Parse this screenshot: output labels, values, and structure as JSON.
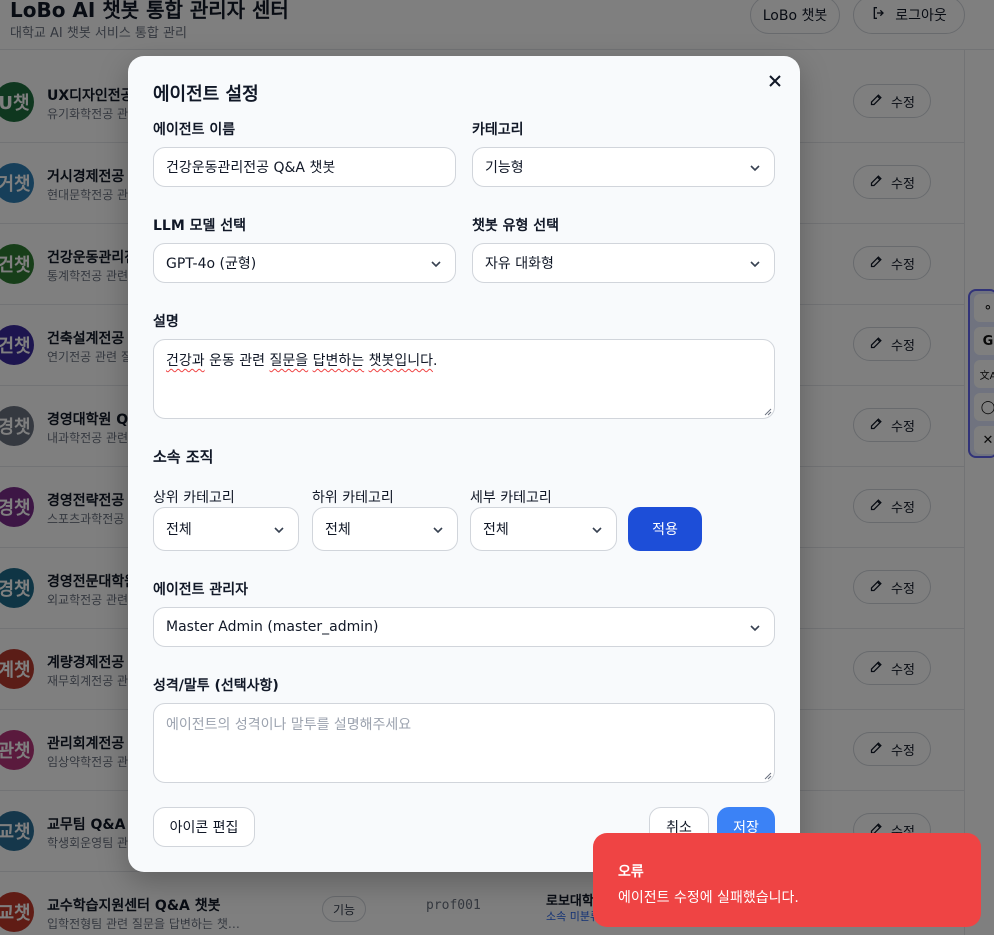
{
  "header": {
    "title": "LoBo AI 챗봇 통합 관리자 센터",
    "subtitle": "대학교 AI 챗봇 서비스 통합 관리",
    "lobo_button": "LoBo 챗봇",
    "logout_button": "로그아웃"
  },
  "rows": [
    {
      "avatar": "U챗",
      "color": "#1f6f3f",
      "name": "UX디자인전공 Q&A 챗봇",
      "desc": "유기화학전공 관련 질문을 답변하는 챗봇입니다.",
      "edit": "수정"
    },
    {
      "avatar": "거챗",
      "color": "#2f7fb5",
      "name": "거시경제전공 Q&A 챗봇",
      "desc": "현대문학전공 관련 질문을 답변하는 챗봇입니다.",
      "edit": "수정"
    },
    {
      "avatar": "건챗",
      "color": "#2e7d32",
      "name": "건강운동관리전공 Q&A 챗봇",
      "desc": "통계학전공 관련 질문을 답변하는 챗봇입니다.",
      "edit": "수정"
    },
    {
      "avatar": "건챗",
      "color": "#3b2a9e",
      "name": "건축설계전공 Q&A 챗봇",
      "desc": "연기전공 관련 질문을 답변하는 챗봇입니다.",
      "edit": "수정"
    },
    {
      "avatar": "경챗",
      "color": "#6b7280",
      "name": "경영대학원 Q&A 챗봇",
      "desc": "내과학전공 관련 질문을 답변하는 챗봇입니다.",
      "edit": "수정"
    },
    {
      "avatar": "경챗",
      "color": "#7b2d8b",
      "name": "경영전략전공 Q&A 챗봇",
      "desc": "스포츠과학전공 관련 질문을 답변하는 챗봇입니다.",
      "edit": "수정"
    },
    {
      "avatar": "경챗",
      "color": "#1e6b8a",
      "name": "경영전문대학원 Q&A 챗봇",
      "desc": "외교학전공 관련 질문을 답변하는 챗봇입니다.",
      "edit": "수정"
    },
    {
      "avatar": "계챗",
      "color": "#b73a2e",
      "name": "계량경제전공 Q&A 챗봇",
      "desc": "재무회계전공 관련 질문을 답변하는 챗봇입니다.",
      "edit": "수정"
    },
    {
      "avatar": "관챗",
      "color": "#b5357a",
      "name": "관리회계전공 Q&A 챗봇",
      "desc": "임상약학전공 관련 질문을 답변하는 챗봇입니다.",
      "edit": "수정"
    },
    {
      "avatar": "교챗",
      "color": "#2a6f97",
      "name": "교무팀 Q&A 챗봇",
      "desc": "학생회운영팀 관련 질문을 답변하는 챗봇입니다.",
      "edit": "수정"
    },
    {
      "avatar": "교챗",
      "color": "#c0392b",
      "name": "교수학습지원센터 Q&A 챗봇",
      "desc": "입학전형팀 관련 질문을 답변하는 챗…",
      "tag": "기능",
      "user": "prof001",
      "org": "로보대학교",
      "org_sub": "소속 미분류"
    }
  ],
  "side_tools": [
    "⚬",
    "G",
    "文A",
    "◯",
    "✕"
  ],
  "modal": {
    "title": "에이전트 설정",
    "name_label": "에이전트 이름",
    "name_value": "건강운동관리전공 Q&A 챗봇",
    "category_label": "카테고리",
    "category_value": "기능형",
    "llm_label": "LLM 모델 선택",
    "llm_value": "GPT-4o (균형)",
    "type_label": "챗봇 유형 선택",
    "type_value": "자유 대화형",
    "desc_label": "설명",
    "desc_value_part1": "건강과",
    "desc_value_part2": " 운동 관련 ",
    "desc_value_part3": "질문을",
    "desc_value_part4": " ",
    "desc_value_part5": "답변하는",
    "desc_value_part6": " ",
    "desc_value_part7": "챗봇입니다",
    "desc_value_part8": ".",
    "org_section": "소속 조직",
    "upper_label": "상위 카테고리",
    "upper_value": "전체",
    "lower_label": "하위 카테고리",
    "lower_value": "전체",
    "detail_label": "세부 카테고리",
    "detail_value": "전체",
    "apply_button": "적용",
    "manager_label": "에이전트 관리자",
    "manager_value": "Master Admin (master_admin)",
    "persona_label": "성격/말투 (선택사항)",
    "persona_placeholder": "에이전트의 성격이나 말투를 설명해주세요",
    "icon_edit_button": "아이콘 편집",
    "cancel_button": "취소",
    "save_button": "저장"
  },
  "toast": {
    "title": "오류",
    "message": "에이전트 수정에 실패했습니다."
  },
  "colors": {
    "primary": "#1d4ed8",
    "save": "#3b82f6",
    "error": "#ef4444"
  }
}
